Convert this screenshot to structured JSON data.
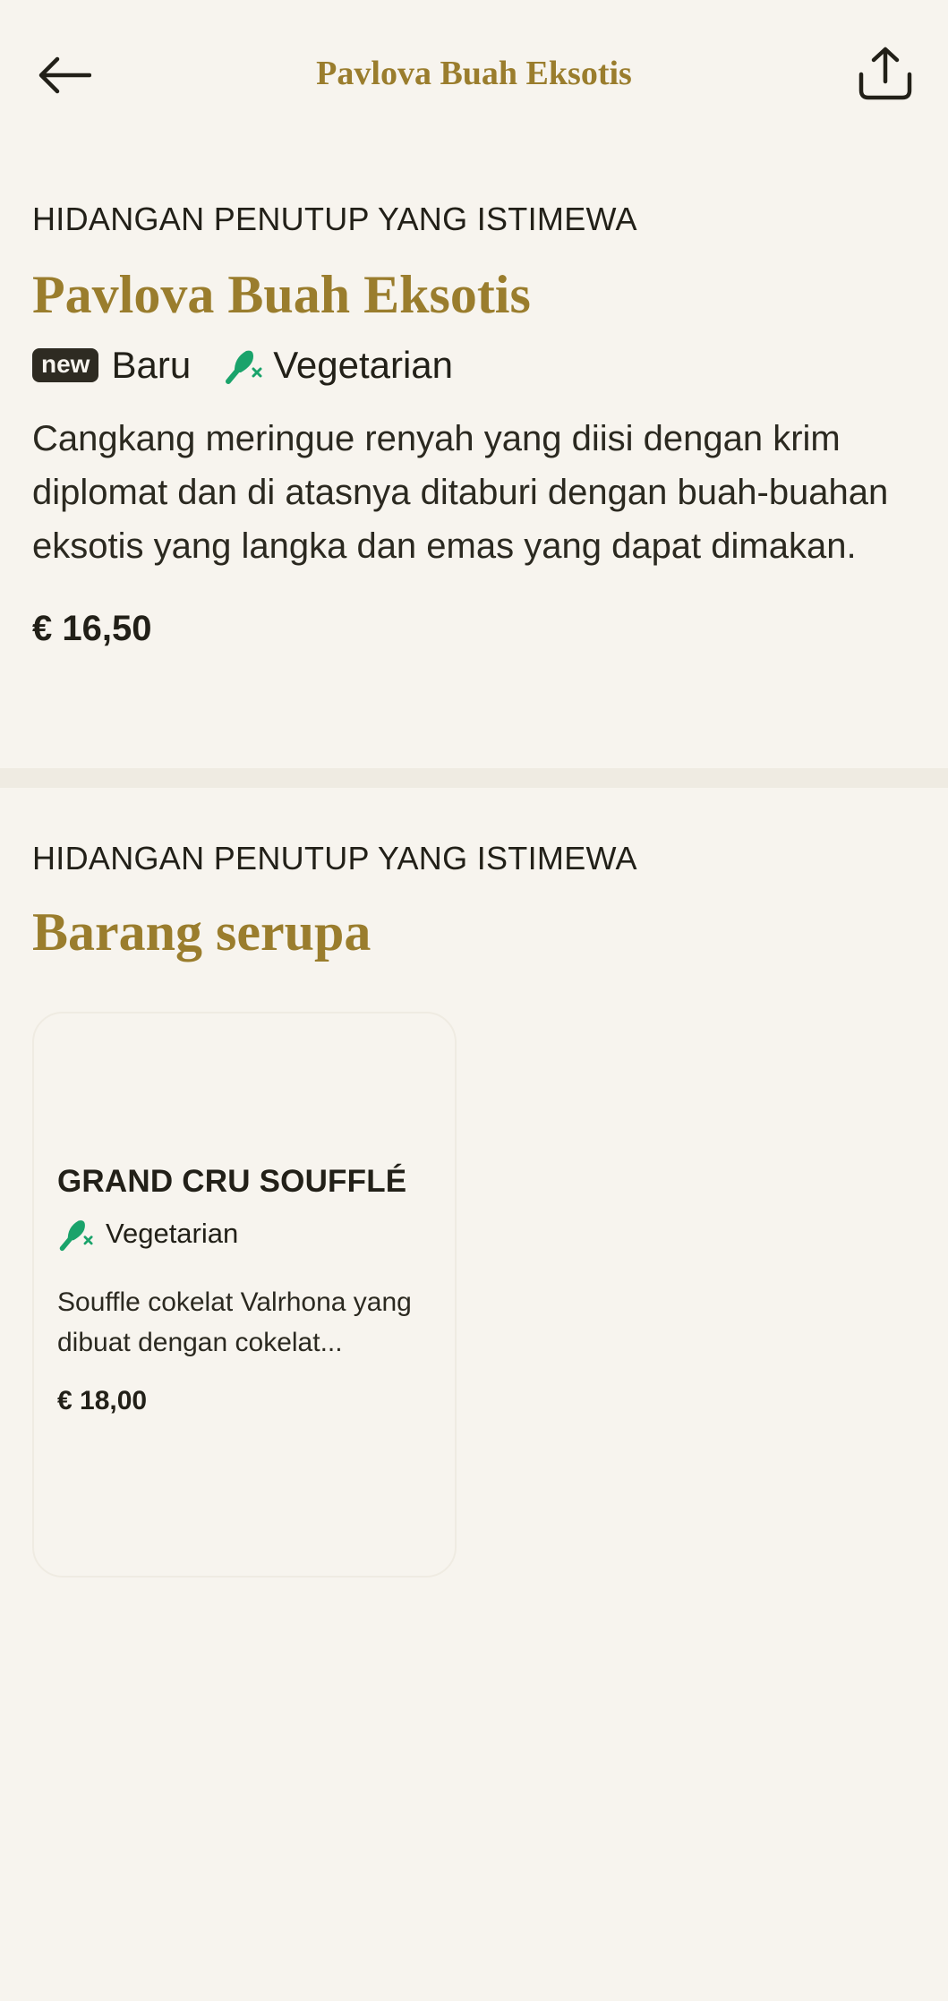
{
  "header": {
    "title": "Pavlova Buah Eksotis",
    "back_icon": "arrow-left-icon",
    "share_icon": "share-icon"
  },
  "item": {
    "category": "HIDANGAN PENUTUP YANG ISTIMEWA",
    "name": "Pavlova Buah Eksotis",
    "new_badge": "new",
    "new_label": "Baru",
    "veg_label": "Vegetarian",
    "description": "Cangkang meringue renyah yang diisi dengan krim diplomat dan di atasnya ditaburi dengan buah-buahan eksotis yang langka dan emas yang dapat dimakan.",
    "price": "€ 16,50"
  },
  "similar": {
    "category": "HIDANGAN PENUTUP YANG ISTIMEWA",
    "title": "Barang serupa",
    "items": [
      {
        "name": "GRAND CRU SOUFFLÉ",
        "veg_label": "Vegetarian",
        "description": "Souffle cokelat Valrhona yang dibuat dengan cokelat...",
        "price": "€ 18,00"
      }
    ]
  },
  "colors": {
    "background": "#f7f4ee",
    "accent_gold": "#9a7d2d",
    "veg_green": "#1aa36b",
    "text": "#222018"
  }
}
